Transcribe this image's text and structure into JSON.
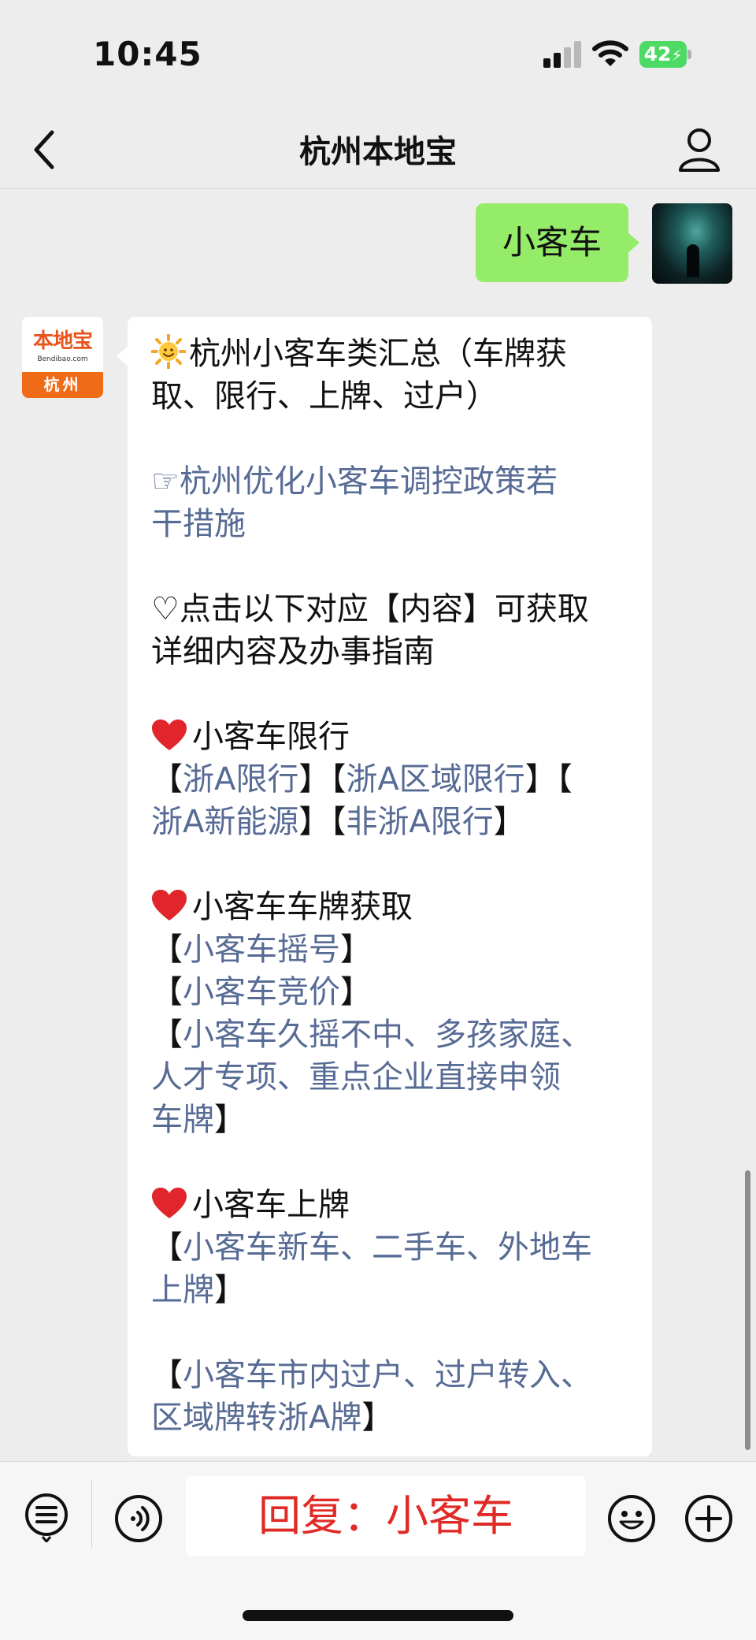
{
  "status_bar": {
    "time": "10:45",
    "battery": "42"
  },
  "nav": {
    "title": "杭州本地宝"
  },
  "outgoing": {
    "text": "小客车"
  },
  "bot_avatar": {
    "logo": "本地宝",
    "logo_sub": "Bendibao.com",
    "city": "杭州"
  },
  "incoming": {
    "summary_title_l1": "杭州小客车类汇总（车牌获",
    "summary_title_l2": "取、限行、上牌、过户）",
    "policy_link_l1": "☞杭州优化小客车调控政策若",
    "policy_link_l2": "干措施",
    "hint_l1": "♡点击以下对应【内容】可获取",
    "hint_l2": "详细内容及办事指南",
    "section_restrict_title": "小客车限行",
    "restrict_line1": {
      "b1": "【",
      "link1": "浙A限行",
      "b2": "】【",
      "link2": "浙A区域限行",
      "b3": "】【"
    },
    "restrict_line2": {
      "link3": "浙A新能源",
      "b4": "】【",
      "link4": "非浙A限行",
      "b5": "】"
    },
    "section_plate_title": "小客车车牌获取",
    "plate_lottery": {
      "open": "【",
      "link": "小客车摇号",
      "close": "】"
    },
    "plate_bid": {
      "open": "【",
      "link": "小客车竞价",
      "close": "】"
    },
    "plate_direct": {
      "open": "【",
      "link_l1": "小客车久摇不中、多孩家庭、",
      "link_l2": "人才专项、重点企业直接申领",
      "link_l3": "车牌",
      "close": "】"
    },
    "section_register_title": "小客车上牌",
    "register": {
      "open": "【",
      "link_l1": "小客车新车、二手车、外地车",
      "link_l2": "上牌",
      "close": "】"
    },
    "transfer": {
      "open": "【",
      "link_l1": "小客车市内过户、过户转入、",
      "link_l2": "区域牌转浙A牌",
      "close": "】"
    }
  },
  "input_bar": {
    "text": "回复：小客车"
  },
  "colors": {
    "link": "#576b95",
    "outgoing_bubble": "#95ec69",
    "input_text": "#e02a26",
    "battery": "#4cd964"
  },
  "icons": [
    "back-icon",
    "profile-icon",
    "sun-emoji-icon",
    "heart-emoji-icon",
    "menu-icon",
    "voice-icon",
    "emoji-icon",
    "plus-icon"
  ]
}
